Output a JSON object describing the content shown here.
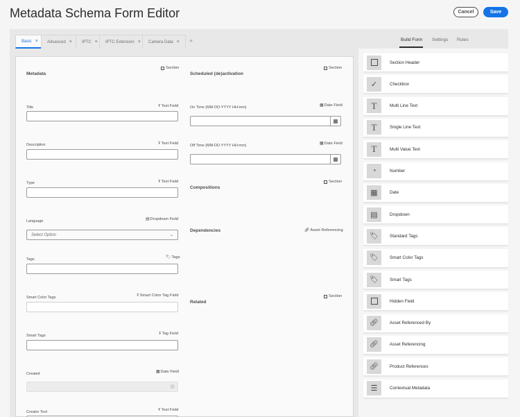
{
  "header": {
    "title": "Metadata Schema Form Editor",
    "cancel_label": "Cancel",
    "save_label": "Save"
  },
  "tabs": [
    {
      "label": "Basic",
      "active": true
    },
    {
      "label": "Advanced"
    },
    {
      "label": "IPTC"
    },
    {
      "label": "IPTC Extension"
    },
    {
      "label": "Camera Data"
    }
  ],
  "add_tab_label": "+",
  "close_glyph": "×",
  "right_tabs": {
    "build_form": "Build Form",
    "settings": "Settings",
    "rules": "Rules"
  },
  "left_col": {
    "section_title": "Metadata",
    "section_type": "Section",
    "fields": [
      {
        "label": "Title",
        "type": "Text Field"
      },
      {
        "label": "Description",
        "type": "Text Field"
      },
      {
        "label": "Type",
        "type": "Text Field"
      },
      {
        "label": "Language",
        "type": "Dropdown Field",
        "placeholder": "Select Option"
      },
      {
        "label": "Tags",
        "type": "Tags"
      },
      {
        "label": "Smart Color Tags",
        "type": "Smart Color Tag Field"
      },
      {
        "label": "Smart Tags",
        "type": "Tag Field"
      },
      {
        "label": "Created",
        "type": "Date Field"
      },
      {
        "label": "Creator Tool",
        "type": "Text Field"
      }
    ]
  },
  "right_col": {
    "scheduled_title": "Scheduled (de)activation",
    "scheduled_type": "Section",
    "on_time_label": "On Time (MM-DD-YYYY HH:mm)",
    "on_time_type": "Date Field",
    "off_time_label": "Off Time (MM-DD-YYYY HH:mm)",
    "off_time_type": "Date Field",
    "compositions_title": "Compositions",
    "compositions_type": "Section",
    "dependencies_title": "Dependencies",
    "dependencies_type": "Asset Referencing",
    "related_title": "Related",
    "related_type": "Section"
  },
  "components": [
    {
      "label": "Section Header",
      "icon": "square-icon"
    },
    {
      "label": "Checkbox",
      "icon": "checkmark-icon"
    },
    {
      "label": "Multi Line Text",
      "icon": "text-icon"
    },
    {
      "label": "Single Line Text",
      "icon": "text-icon"
    },
    {
      "label": "Multi Value Text",
      "icon": "text-icon"
    },
    {
      "label": "Number",
      "icon": "gauge-icon"
    },
    {
      "label": "Date",
      "icon": "calendar-icon"
    },
    {
      "label": "Dropdown",
      "icon": "dropdown-icon"
    },
    {
      "label": "Standard Tags",
      "icon": "tag-icon"
    },
    {
      "label": "Smart Color Tags",
      "icon": "tag-icon"
    },
    {
      "label": "Smart Tags",
      "icon": "tag-icon"
    },
    {
      "label": "Hidden Field",
      "icon": "square-icon"
    },
    {
      "label": "Asset Referenced By",
      "icon": "link-icon"
    },
    {
      "label": "Asset Referencing",
      "icon": "link-icon"
    },
    {
      "label": "Product References",
      "icon": "link-icon"
    },
    {
      "label": "Contextual Metadata",
      "icon": "list-icon"
    }
  ],
  "colors": {
    "accent": "#1473e6",
    "panel": "#e8e8e8",
    "form_bg": "#fafafa",
    "icon_bg": "#d8d8d8"
  }
}
